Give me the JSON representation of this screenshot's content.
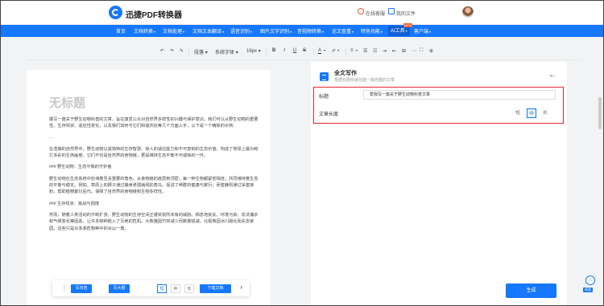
{
  "header": {
    "brand": "迅捷PDF转换器",
    "online_service": "在线客服",
    "my_files": "我的文件"
  },
  "nav": {
    "items": [
      {
        "label": "首页",
        "dropdown": false
      },
      {
        "label": "文档转换",
        "dropdown": true
      },
      {
        "label": "文档处理",
        "dropdown": true
      },
      {
        "label": "文档文本翻译",
        "dropdown": true
      },
      {
        "label": "语音识别",
        "dropdown": true
      },
      {
        "label": "图片文字识别",
        "dropdown": true
      },
      {
        "label": "音视频转换",
        "dropdown": true
      },
      {
        "label": "论文查重",
        "dropdown": true
      },
      {
        "label": "特色功能",
        "dropdown": true
      },
      {
        "label": "AI工具",
        "dropdown": true,
        "active": true
      },
      {
        "label": "客户端",
        "dropdown": true
      }
    ],
    "new_badge": "NEW"
  },
  "toolbar": {
    "paragraph": "段落",
    "font_family": "系统字体",
    "font_size": "16px"
  },
  "editor": {
    "title_placeholder": "无标题",
    "paragraphs": [
      "撰写一篇关于野生动物科普的文章，旨在激发公众对自然界多样性的兴趣与保护意识。我们可以从野生动物的重要性、生存现状、适应性变化，以及我们如何与它们和谐共处等几个方面入手，以下是一个精炼的示例：",
      "···",
      "在浩瀚的自然界中，野生动物以其独特的生存智慧、惊人的适应能力和不可复制的生态价值，构成了地球上最为绚烂多彩的生命画卷。它们不仅是自然界的食物链，更是维持生态平衡不可或缺的一环。",
      "### 野生动物：生态平衡的守护者",
      "野生动物在生态系统中扮演着至关重要的角色。从食物链的底层到顶层，每一种生物都紧密相连，共同维持着生态的平衡与稳定。例如，草原上的狮子通过捕食老弱病残的角马，促进了种群的健康与繁衍；而蜜蜂则通过采蜜授粉，帮助植物繁衍后代，保障了自然界的食物链和生物多样性。",
      "### 生存现状：挑战与困境",
      "然而，随着人类活动的不断扩张，野生动物的生存空间正遭受前所未有的威胁。栖息地丧失、环境污染、非法捕杀和气候变化等因素，让许多物种陷入了灭绝的危机。大熊猫因竹林减少而数量锐减，北极熊因冰川融化而失去家园，这些只是众多濒危物种中的冰山一角。"
    ]
  },
  "bottom_bar": {
    "rewrite": "写内容",
    "outline": "写大纲",
    "len_short": "短",
    "len_mid": "中",
    "len_long": "长",
    "download": "下载文档"
  },
  "panel": {
    "title": "全文写作",
    "subtitle": "根据标题快速创建一篇完整的文章",
    "title_label": "标题",
    "title_value": "帮我写一篇关于野生动物科普文章",
    "length_label": "文章长度",
    "length_options": [
      "短",
      "中",
      "长"
    ],
    "length_selected": "中",
    "generate": "生成"
  },
  "floating": {
    "badge": "新版"
  },
  "colors": {
    "primary": "#1677ff",
    "highlight_border": "#e0262d"
  }
}
